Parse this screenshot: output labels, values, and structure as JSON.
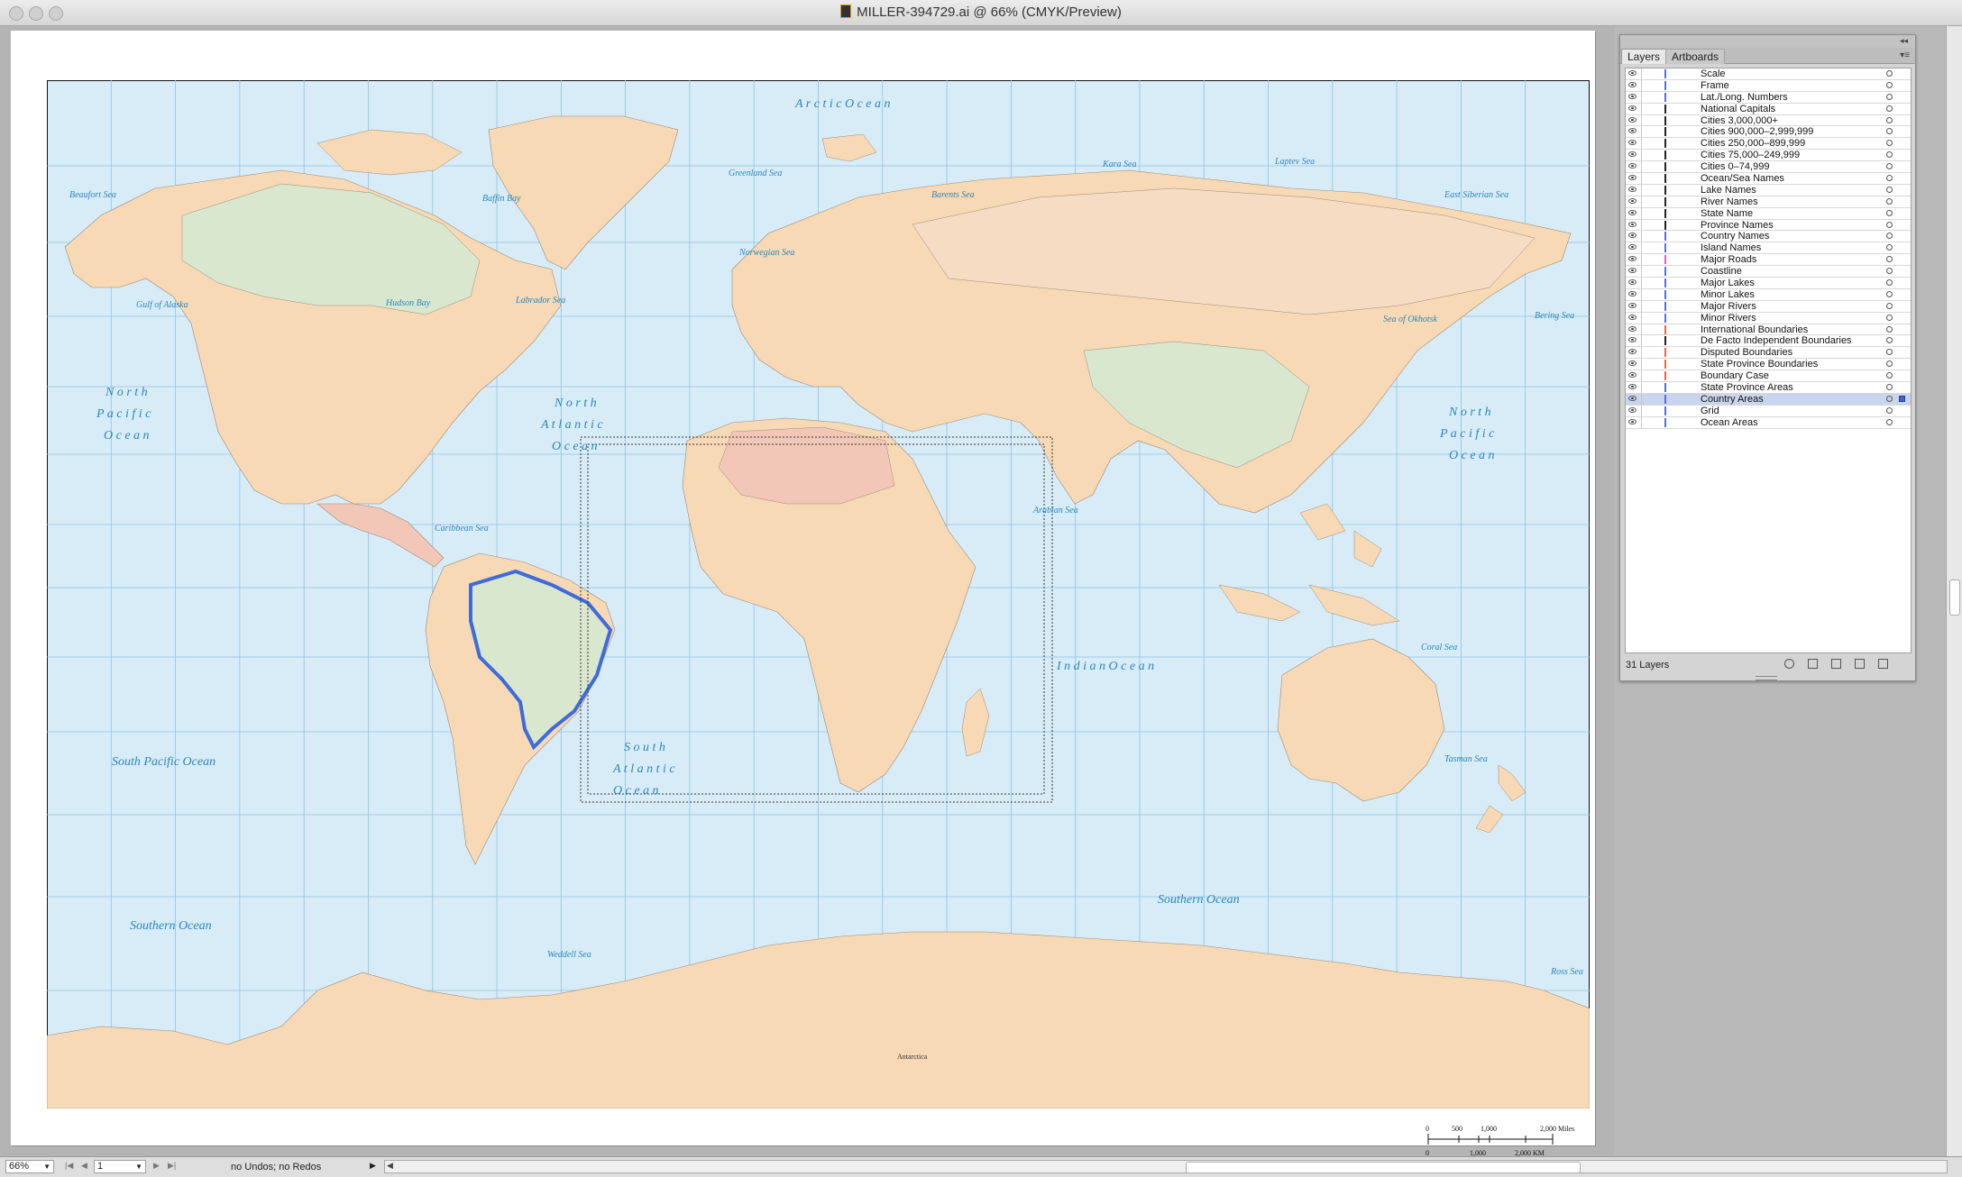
{
  "window": {
    "title": "MILLER-394729.ai @ 66% (CMYK/Preview)"
  },
  "map": {
    "oceans": [
      {
        "name": "Arctic Ocean",
        "label": "A r c t i c   O c e a n"
      },
      {
        "name": "North Pacific Ocean (west)",
        "lines": [
          "N o r t h",
          "P a c i f i c",
          "O c e a n"
        ]
      },
      {
        "name": "North Atlantic Ocean",
        "lines": [
          "N o r t h",
          "A t l a n t i c",
          "O c e a n"
        ]
      },
      {
        "name": "North Pacific Ocean (east)",
        "lines": [
          "N o r t h",
          "P a c i f i c",
          "O c e a n"
        ]
      },
      {
        "name": "South Atlantic Ocean",
        "lines": [
          "S o u t h",
          "A t l a n t i c",
          "O c e a n"
        ]
      },
      {
        "name": "Indian Ocean",
        "label": "I n d i a n   O c e a n"
      },
      {
        "name": "South Pacific Ocean",
        "label": "South Pacific Ocean"
      },
      {
        "name": "Southern Ocean (west)",
        "label": "Southern Ocean"
      },
      {
        "name": "Southern Ocean (east)",
        "label": "Southern Ocean"
      }
    ],
    "seas": [
      "Beaufort Sea",
      "Baffin Bay",
      "Greenland Sea",
      "Barents Sea",
      "Kara Sea",
      "Laptev Sea",
      "East Siberian Sea",
      "Hudson Bay",
      "Labrador Sea",
      "Norwegian Sea",
      "Gulf of Alaska",
      "Bering Sea",
      "Sea of Okhotsk",
      "Caribbean Sea",
      "Arabian Sea",
      "Coral Sea",
      "Tasman Sea",
      "Weddell Sea",
      "Ross Sea"
    ],
    "continent_label": "Antarctica",
    "colors": {
      "ocean": "#d8ecf7",
      "land": "#f7d9b5",
      "grid": "#7ab6de",
      "label": "#2a86b8",
      "highlight": "#3e6bdb"
    }
  },
  "scale": {
    "miles_ticks": [
      "0",
      "500",
      "1,000",
      "2,000 Miles"
    ],
    "km_ticks": [
      "0",
      "1,000",
      "2,000 KM"
    ]
  },
  "layers_panel": {
    "tabs": [
      "Layers",
      "Artboards"
    ],
    "layers": [
      {
        "name": "Scale",
        "color": "#5470d8"
      },
      {
        "name": "Frame",
        "color": "#5470d8"
      },
      {
        "name": "Lat./Long. Numbers",
        "color": "#5470d8"
      },
      {
        "name": "National Capitals",
        "color": "#222222"
      },
      {
        "name": "Cities 3,000,000+",
        "color": "#222222"
      },
      {
        "name": "Cities 900,000–2,999,999",
        "color": "#222222"
      },
      {
        "name": "Cities 250,000–899,999",
        "color": "#222222"
      },
      {
        "name": "Cities 75,000–249,999",
        "color": "#222222"
      },
      {
        "name": "Cities 0–74,999",
        "color": "#222222"
      },
      {
        "name": "Ocean/Sea Names",
        "color": "#222222"
      },
      {
        "name": "Lake Names",
        "color": "#222222"
      },
      {
        "name": "River Names",
        "color": "#222222"
      },
      {
        "name": "State Name",
        "color": "#222222"
      },
      {
        "name": "Province Names",
        "color": "#222222"
      },
      {
        "name": "Country Names",
        "color": "#5470d8"
      },
      {
        "name": "Island Names",
        "color": "#5470d8"
      },
      {
        "name": "Major Roads",
        "color": "#e05ad0"
      },
      {
        "name": "Coastline",
        "color": "#5470d8"
      },
      {
        "name": "Major Lakes",
        "color": "#5470d8"
      },
      {
        "name": "Minor Lakes",
        "color": "#5470d8"
      },
      {
        "name": "Major Rivers",
        "color": "#5470d8"
      },
      {
        "name": "Minor Rivers",
        "color": "#5470d8"
      },
      {
        "name": "International Boundaries",
        "color": "#e06a48"
      },
      {
        "name": "De Facto Independent Boundaries",
        "color": "#222222"
      },
      {
        "name": "Disputed Boundaries",
        "color": "#e06a48"
      },
      {
        "name": "State Province Boundaries",
        "color": "#e06a48"
      },
      {
        "name": "Boundary Case",
        "color": "#e06a48"
      },
      {
        "name": "State Province Areas",
        "color": "#5470d8"
      },
      {
        "name": "Country Areas",
        "color": "#5470d8",
        "selected": true
      },
      {
        "name": "Grid",
        "color": "#5470d8"
      },
      {
        "name": "Ocean Areas",
        "color": "#5470d8"
      }
    ],
    "count_label": "31 Layers"
  },
  "status": {
    "zoom": "66%",
    "artboard": "1",
    "undo_text": "no Undos; no Redos"
  }
}
